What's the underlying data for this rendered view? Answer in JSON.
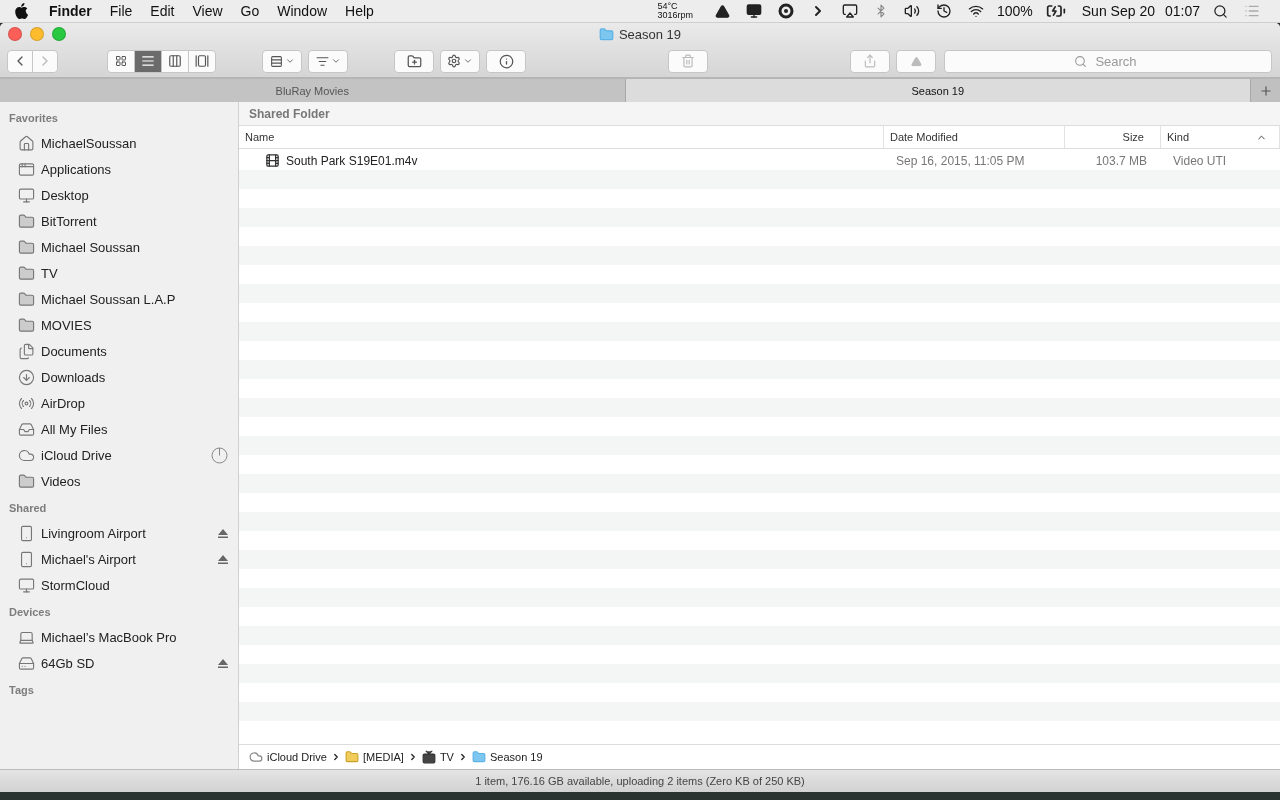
{
  "menu_bar": {
    "app": "Finder",
    "menus": [
      "File",
      "Edit",
      "View",
      "Go",
      "Window",
      "Help"
    ],
    "temperature": "54°C",
    "fan_speed": "3016rpm",
    "battery": "100%",
    "date": "Sun Sep 20",
    "time": "01:07"
  },
  "window": {
    "title": "Season 19"
  },
  "toolbar": {
    "view_buttons": [
      {
        "kind": "icons",
        "selected": false
      },
      {
        "kind": "list",
        "selected": true
      },
      {
        "kind": "columns",
        "selected": false
      },
      {
        "kind": "coverflow",
        "selected": false
      }
    ],
    "buttons": [
      {
        "kind": "arrange",
        "disabled": false
      },
      {
        "kind": "sort",
        "disabled": false
      },
      {
        "kind": "new-folder",
        "disabled": false
      },
      {
        "kind": "action",
        "disabled": false
      },
      {
        "kind": "info",
        "disabled": false
      },
      {
        "kind": "trash",
        "disabled": true
      },
      {
        "kind": "share",
        "disabled": true
      },
      {
        "kind": "eject",
        "disabled": true
      }
    ],
    "search": {
      "placeholder": "Search"
    }
  },
  "tabs": [
    {
      "label": "BluRay Movies",
      "selected": false
    },
    {
      "label": "Season 19",
      "selected": true
    }
  ],
  "sidebar": {
    "sections": [
      {
        "title": "Favorites",
        "items": [
          {
            "label": "MichaelSoussan",
            "kind": "home"
          },
          {
            "label": "Applications",
            "kind": "apps"
          },
          {
            "label": "Desktop",
            "kind": "desktop"
          },
          {
            "label": "BitTorrent",
            "kind": "folder"
          },
          {
            "label": "Michael Soussan",
            "kind": "folder"
          },
          {
            "label": "TV",
            "kind": "folder"
          },
          {
            "label": "Michael Soussan L.A.P",
            "kind": "folder"
          },
          {
            "label": "MOVIES",
            "kind": "folder"
          },
          {
            "label": "Documents",
            "kind": "documents"
          },
          {
            "label": "Downloads",
            "kind": "downloads"
          },
          {
            "label": "AirDrop",
            "kind": "airdrop"
          },
          {
            "label": "All My Files",
            "kind": "allfiles"
          },
          {
            "label": "iCloud Drive",
            "kind": "cloud",
            "syncing": true
          },
          {
            "label": "Videos",
            "kind": "folder"
          }
        ]
      },
      {
        "title": "Shared",
        "items": [
          {
            "label": "Livingroom Airport",
            "kind": "airport",
            "ejectable": true
          },
          {
            "label": "Michael's Airport",
            "kind": "airport",
            "ejectable": true
          },
          {
            "label": "StormCloud",
            "kind": "display"
          }
        ]
      },
      {
        "title": "Devices",
        "items": [
          {
            "label": "Michael’s MacBook Pro",
            "kind": "laptop"
          },
          {
            "label": "64Gb SD",
            "kind": "drive",
            "ejectable": true
          }
        ]
      },
      {
        "title": "Tags"
      }
    ]
  },
  "content": {
    "header": "Shared Folder",
    "columns": [
      {
        "label": "Name",
        "sorted": false
      },
      {
        "label": "Date Modified",
        "sorted": false
      },
      {
        "label": "Size",
        "sorted": false
      },
      {
        "label": "Kind",
        "sorted": true
      }
    ],
    "rows": [
      {
        "name": "South Park S19E01.m4v",
        "date_modified": "Sep 16, 2015, 11:05 PM",
        "size": "103.7 MB",
        "kind": "Video UTI"
      }
    ]
  },
  "path_bar": [
    {
      "label": "iCloud Drive",
      "kind": "cloud"
    },
    {
      "label": "[MEDIA]",
      "kind": "shared-folder"
    },
    {
      "label": "TV",
      "kind": "display"
    },
    {
      "label": "Season 19",
      "kind": "folder"
    }
  ],
  "status_bar": "1 item, 176.16 GB available, uploading 2 items (Zero KB of 250 KB)"
}
